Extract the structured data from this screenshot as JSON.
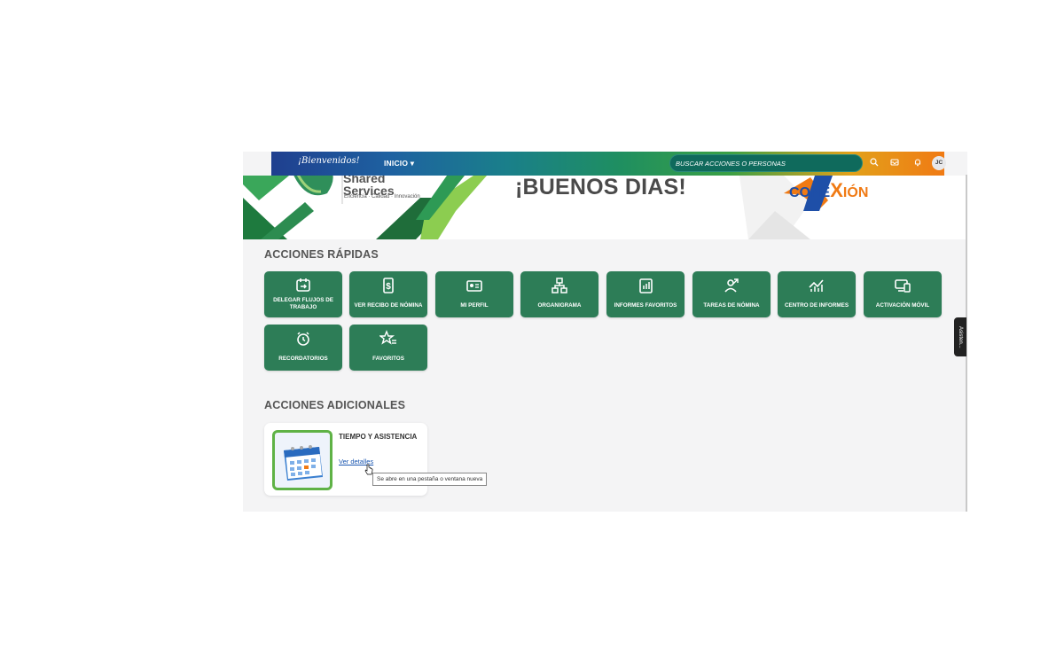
{
  "header": {
    "welcome": "¡Bienvenidos!",
    "nav_menu": "INICIO",
    "search_placeholder": "BUSCAR ACCIONES O PERSONAS",
    "avatar_initials": "JC"
  },
  "banner": {
    "greeting": "¡BUENOS DIAS!",
    "brand_line1": "Shared",
    "brand_line2": "Services",
    "brand_tagline": "Eficiencia · Calidad · Innovación",
    "logo_part1": "CONE",
    "logo_part2": "X",
    "logo_part3": "IÓN"
  },
  "quick_actions": {
    "title": "ACCIONES RÁPIDAS",
    "items": [
      {
        "label": "DELEGAR FLUJOS DE TRABAJO",
        "icon": "calendar-arrow-icon"
      },
      {
        "label": "VER RECIBO DE NÓMINA",
        "icon": "receipt-dollar-icon"
      },
      {
        "label": "MI PERFIL",
        "icon": "id-card-icon"
      },
      {
        "label": "ORGANIGRAMA",
        "icon": "org-chart-icon"
      },
      {
        "label": "INFORMES FAVORITOS",
        "icon": "favorite-report-icon"
      },
      {
        "label": "TAREAS DE NÓMINA",
        "icon": "payroll-tasks-icon"
      },
      {
        "label": "CENTRO DE INFORMES",
        "icon": "analytics-icon"
      },
      {
        "label": "ACTIVACIÓN MÓVIL",
        "icon": "mobile-device-icon"
      },
      {
        "label": "RECORDATORIOS",
        "icon": "reminder-clock-icon"
      },
      {
        "label": "FAVORITOS",
        "icon": "star-list-icon"
      }
    ]
  },
  "additional_actions": {
    "title": "ACCIONES ADICIONALES",
    "card": {
      "title": "TIEMPO Y ASISTENCIA",
      "link": "Ver detalles",
      "tooltip": "Se abre en una pestaña o ventana nueva"
    }
  },
  "side_tab": "Asisten..."
}
